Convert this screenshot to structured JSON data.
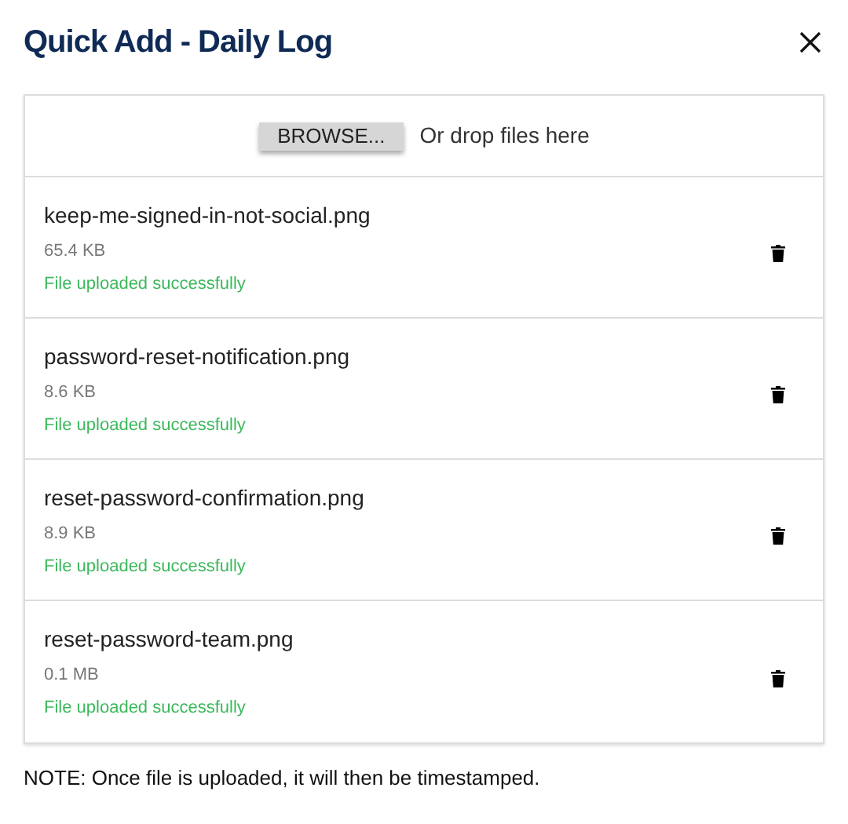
{
  "dialog": {
    "title": "Quick Add - Daily Log"
  },
  "upload": {
    "browse_button": "BROWSE...",
    "drop_hint": "Or drop files here"
  },
  "files": [
    {
      "name": "keep-me-signed-in-not-social.png",
      "size": "65.4 KB",
      "status": "File uploaded successfully",
      "kind": "success"
    },
    {
      "name": "password-reset-notification.png",
      "size": "8.6 KB",
      "status": "File uploaded successfully",
      "kind": "success"
    },
    {
      "name": "reset-password-confirmation.png",
      "size": "8.9 KB",
      "status": "File uploaded successfully",
      "kind": "success"
    },
    {
      "name": "reset-password-team.png",
      "size": "0.1 MB",
      "status": "File uploaded successfully",
      "kind": "success"
    }
  ],
  "note": "NOTE: Once file is uploaded, it will then be timestamped."
}
